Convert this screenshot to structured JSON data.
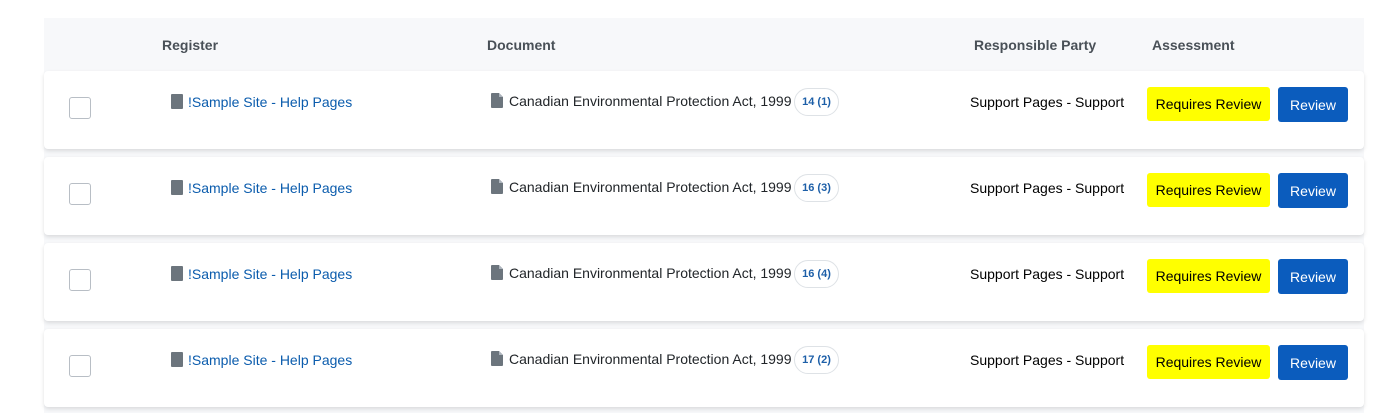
{
  "table": {
    "headers": {
      "register": "Register",
      "document": "Document",
      "responsible_party": "Responsible Party",
      "assessment": "Assessment"
    },
    "rows": [
      {
        "register": "!Sample Site - Help Pages",
        "document": "Canadian Environmental Protection Act, 1999",
        "count": "14 (1)",
        "responsible_party": "Support Pages - Support",
        "assessment": "Requires Review",
        "action": "Review"
      },
      {
        "register": "!Sample Site - Help Pages",
        "document": "Canadian Environmental Protection Act, 1999",
        "count": "16 (3)",
        "responsible_party": "Support Pages - Support",
        "assessment": "Requires Review",
        "action": "Review"
      },
      {
        "register": "!Sample Site - Help Pages",
        "document": "Canadian Environmental Protection Act, 1999",
        "count": "16 (4)",
        "responsible_party": "Support Pages - Support",
        "assessment": "Requires Review",
        "action": "Review"
      },
      {
        "register": "!Sample Site - Help Pages",
        "document": "Canadian Environmental Protection Act, 1999",
        "count": "17 (2)",
        "responsible_party": "Support Pages - Support",
        "assessment": "Requires Review",
        "action": "Review"
      }
    ]
  },
  "icons": {
    "register": "register-file-icon",
    "document": "document-icon"
  },
  "colors": {
    "link": "#0b5cad",
    "assessment_badge": "#ffff00",
    "review_button": "#0b5cbd",
    "header_bg": "#f7f8fa"
  }
}
